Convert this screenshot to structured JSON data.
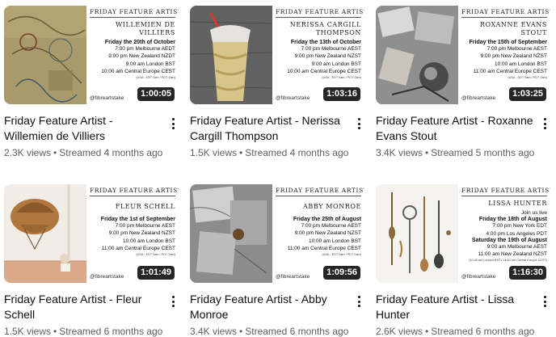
{
  "videos": [
    {
      "duration": "1:00:05",
      "title": "Friday Feature Artist - Willemien de Villiers",
      "views": "2.3K views",
      "streamed": "Streamed 4 months ago",
      "poster": {
        "heading": "FRIDAY FEATURE ARTIST",
        "name": "WILLEMIEN DE VILLIERS",
        "date": "Friday the 20th of October",
        "lines": [
          "7:00 pm Melbourne AEDT",
          "9:00 pm New Zealand NZDT",
          "9:00 am London BST",
          "10:00 am Central Europe CEST"
        ],
        "foot": "(USA - EDT 4am / PDT 1am)",
        "handle": "@fibreartstake"
      }
    },
    {
      "duration": "1:03:16",
      "title": "Friday Feature Artist - Nerissa Cargill Thompson",
      "views": "1.5K views",
      "streamed": "Streamed 4 months ago",
      "poster": {
        "heading": "FRIDAY FEATURE ARTIST",
        "name": "NERISSA CARGILL THOMPSON",
        "date": "Friday the 13th of October",
        "lines": [
          "7:00 pm Melbourne AEST",
          "9:00 pm New Zealand NZST",
          "9:00 am London BST",
          "10:00 am Central Europe CEST"
        ],
        "foot": "(USA - EDT 4am / PDT 1am)",
        "handle": "@fibreartstake"
      }
    },
    {
      "duration": "1:03:25",
      "title": "Friday Feature Artist - Roxanne Evans Stout",
      "views": "3.4K views",
      "streamed": "Streamed 5 months ago",
      "poster": {
        "heading": "FRIDAY FEATURE ARTIST",
        "name": "ROXANNE EVANS STOUT",
        "date": "Friday the 15th of September",
        "lines": [
          "7:00 pm Melbourne AEST",
          "9:00 pm New Zealand NZST",
          "10:00 am London BST",
          "11:00 am Central Europe CEST"
        ],
        "foot": "(USA - EDT 5am / PDT 2am)",
        "handle": "@fibreartstake"
      }
    },
    {
      "duration": "1:01:49",
      "title": "Friday Feature Artist - Fleur Schell",
      "views": "1.5K views",
      "streamed": "Streamed 6 months ago",
      "poster": {
        "heading": "FRIDAY FEATURE ARTIST",
        "name": "FLEUR SCHELL",
        "date": "Friday the 1st of September",
        "lines": [
          "7:00 pm Melbourne AEST",
          "9:00 pm New Zealand NZST",
          "10:00 am London BST",
          "11:00 am Central Europe CEST"
        ],
        "foot": "(USA - EDT 5am / PDT 2am)",
        "handle": "@fibreartstake"
      }
    },
    {
      "duration": "1:09:56",
      "title": "Friday Feature Artist - Abby Monroe",
      "views": "3.4K views",
      "streamed": "Streamed 6 months ago",
      "poster": {
        "heading": "FRIDAY FEATURE ARTIST",
        "name": "ABBY MONROE",
        "date": "Friday the 25th of August",
        "lines": [
          "7:00 pm Melbourne AEST",
          "9:00 pm New Zealand NZST",
          "10:00 am London BST",
          "11:00 am Central Europe CEST"
        ],
        "foot": "(USA - EDT 5am / PDT 2am)",
        "handle": "@fibreartstake"
      }
    },
    {
      "duration": "1:16:30",
      "title": "Friday Feature Artist - Lissa Hunter",
      "views": "2.6K views",
      "streamed": "Streamed 6 months ago",
      "poster": {
        "heading": "FRIDAY FEATURE ARTIST",
        "name": "LISSA HUNTER",
        "date": "Friday the 18th of August",
        "prelines": [
          "Join us live"
        ],
        "lines": [
          "7:00 pm New York EDT",
          "4:00 pm Los Angeles PDT",
          "Saturday the 19th of August",
          "9:00 am Melbourne AEST",
          "11:00 am New Zealand NZST"
        ],
        "foot": "(10:00 am London BST / 11:00 am Central Europe CEST)",
        "handle": "@fibreartstake"
      }
    }
  ],
  "colors": {
    "meta_text": "#606060",
    "title_text": "#0f0f0f",
    "duration_bg": "#000000"
  }
}
